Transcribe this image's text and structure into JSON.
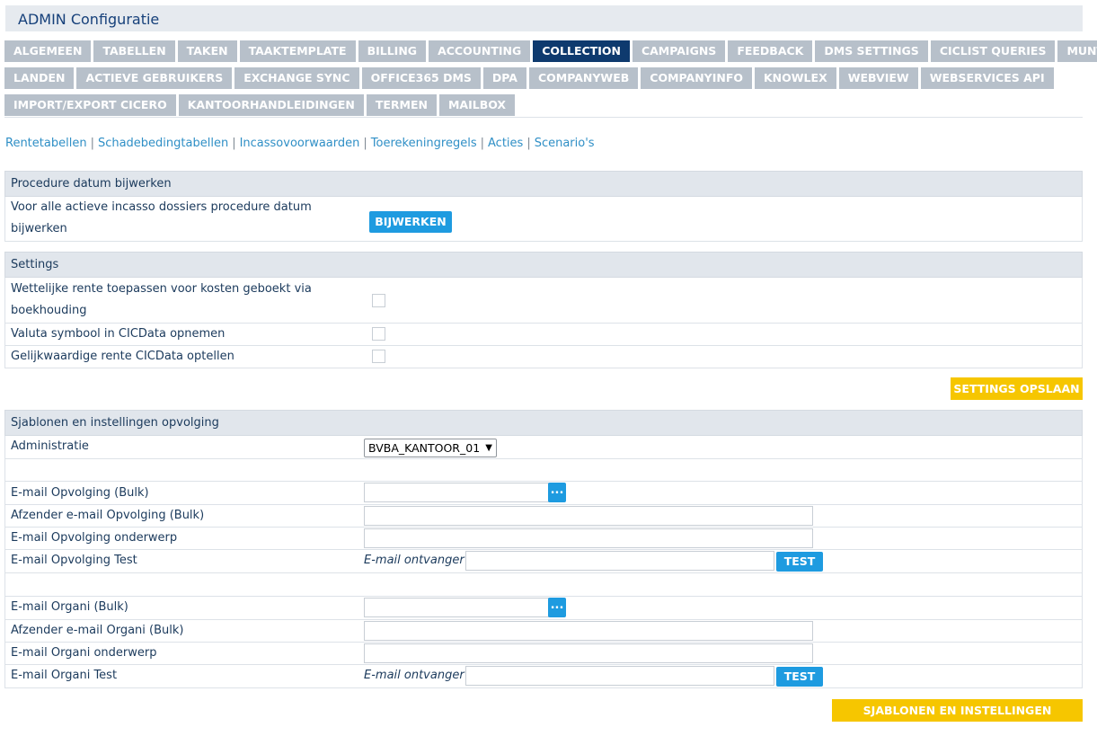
{
  "header": {
    "title": "ADMIN  Configuratie"
  },
  "tabs": {
    "row1": [
      "ALGEMEEN",
      "TABELLEN",
      "TAKEN",
      "TAAKTEMPLATE",
      "BILLING",
      "ACCOUNTING",
      "COLLECTION",
      "CAMPAIGNS",
      "FEEDBACK",
      "DMS SETTINGS",
      "CICLIST QUERIES",
      "MUNTEN"
    ],
    "row2": [
      "LANDEN",
      "ACTIEVE GEBRUIKERS",
      "EXCHANGE SYNC",
      "OFFICE365 DMS",
      "DPA",
      "COMPANYWEB",
      "COMPANYINFO",
      "KNOWLEX",
      "WEBVIEW",
      "WEBSERVICES API"
    ],
    "row3": [
      "IMPORT/EXPORT CICERO",
      "KANTOORHANDLEIDINGEN",
      "TERMEN",
      "MAILBOX"
    ],
    "active": "COLLECTION"
  },
  "sublinks": [
    "Rentetabellen",
    "Schadebedingtabellen",
    "Incassovoorwaarden",
    "Toerekeningregels",
    "Acties",
    "Scenario's"
  ],
  "procedure": {
    "title": "Procedure datum bijwerken",
    "line1": "Voor alle actieve incasso dossiers procedure datum",
    "line2": "bijwerken",
    "button": "BIJWERKEN"
  },
  "settings": {
    "title": "Settings",
    "item1_line1": "Wettelijke rente toepassen voor kosten geboekt via",
    "item1_line2": "boekhouding",
    "item2": "Valuta symbool in CICData opnemen",
    "item3": "Gelijkwaardige rente CICData optellen",
    "save": "SETTINGS OPSLAAN"
  },
  "templates": {
    "title": "Sjablonen en instellingen opvolging",
    "administratie_label": "Administratie",
    "administratie_value": "BVBA_KANTOOR_01",
    "email_opvolging_bulk": "E-mail Opvolging (Bulk)",
    "afzender_opvolging_bulk": "Afzender e-mail Opvolging (Bulk)",
    "opvolging_onderwerp": "E-mail Opvolging onderwerp",
    "opvolging_test": "E-mail Opvolging Test",
    "email_organi_bulk": "E-mail Organi (Bulk)",
    "afzender_organi_bulk": "Afzender e-mail Organi (Bulk)",
    "organi_onderwerp": "E-mail Organi onderwerp",
    "organi_test": "E-mail Organi Test",
    "ontvanger_label": "E-mail ontvanger",
    "dots": "...",
    "test_button": "TEST",
    "save": "SJABLONEN EN INSTELLINGEN OPSLAAN"
  }
}
